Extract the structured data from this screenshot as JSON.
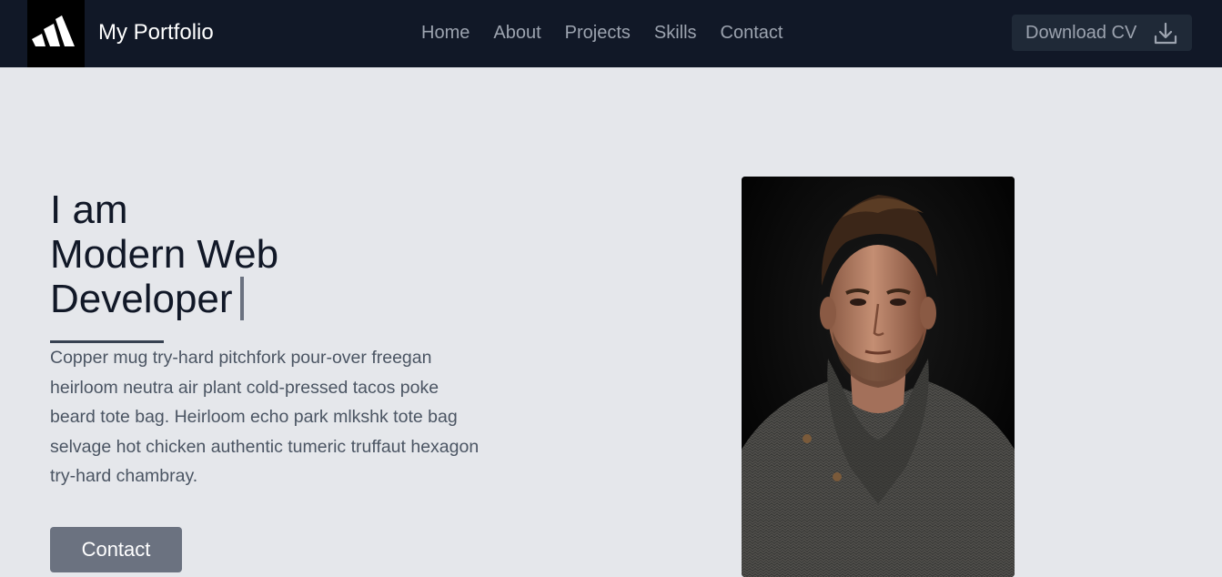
{
  "header": {
    "logo_icon": "three-stripes-logo-icon",
    "brand": "My Portfolio",
    "nav": [
      "Home",
      "About",
      "Projects",
      "Skills",
      "Contact"
    ],
    "download_label": "Download CV",
    "download_icon": "download-icon"
  },
  "hero": {
    "title_line1": "I am",
    "title_line2": "Modern Web",
    "title_line3": "Developer",
    "description": "Copper mug try-hard pitchfork pour-over freegan heirloom neutra air plant cold-pressed tacos poke beard tote bag. Heirloom echo park mlkshk tote bag selvage hot chicken authentic tumeric truffaut hexagon try-hard chambray.",
    "contact_label": "Contact",
    "image": "portrait photo of man in dark knit sweater"
  },
  "colors": {
    "navbar_bg": "#111827",
    "page_bg": "#e5e7eb",
    "button_bg": "#6b7280",
    "heading": "#111827"
  }
}
